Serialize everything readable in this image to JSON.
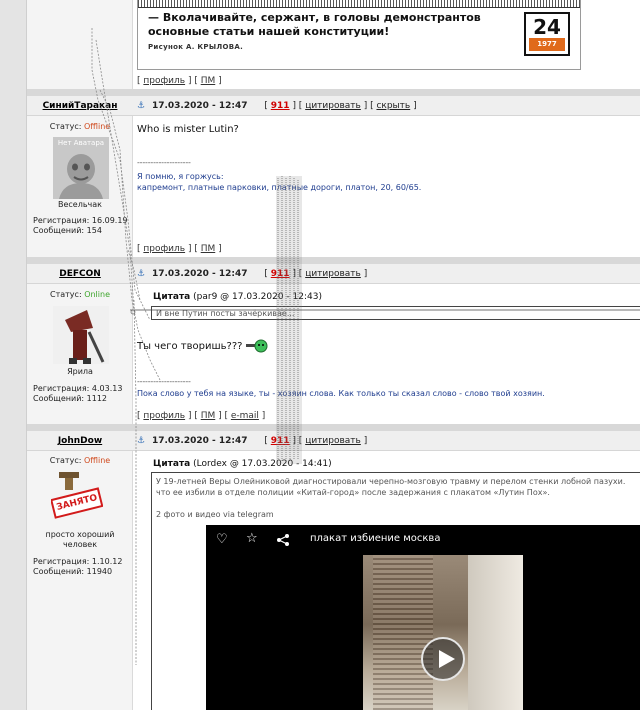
{
  "top_post": {
    "caption": "— Вколачивайте, сержант, в головы демонстрантов основные статьи нашей конституции!",
    "credit": "Рисунок А. КРЫЛОВА.",
    "badge_number": "24",
    "badge_year": "1977",
    "links": [
      "профиль",
      "ПМ"
    ]
  },
  "posts": [
    {
      "author": "СинийТаракан",
      "date": "17.03.2020 - 12:47",
      "post_number": "911",
      "actions": [
        "цитировать",
        "скрыть"
      ],
      "status_label": "Статус:",
      "status": "Offline",
      "avatar_text": [
        "Нет Аватара"
      ],
      "rank": "Весельчак",
      "registration": "Регистрация: 16.09.19",
      "messages": "Сообщений: 154",
      "body": "Who is mister Lutin?",
      "dashes": "--------------------",
      "signature": [
        "Я помню, я горжусь:",
        "капремонт, платные парковки, платные дороги, платон, 20, 60/65."
      ],
      "links": [
        "профиль",
        "ПМ"
      ]
    },
    {
      "author": "DEFCON",
      "date": "17.03.2020 - 12:47",
      "post_number": "911",
      "actions": [
        "цитировать"
      ],
      "status_label": "Статус:",
      "status": "Online",
      "rank": "Ярила",
      "registration": "Регистрация: 4.03.13",
      "messages": "Сообщений: 1112",
      "quote_label": "Цитата",
      "quote_source": "(par9 @ 17.03.2020 - 12:43)",
      "quote_text": "И вне Путин посты зачёркивае...",
      "body": "Ты чего творишь???",
      "dashes": "--------------------",
      "signature": [
        "Пока слово у тебя на языке, ты - хозяин слова. Как только ты сказал слово - слово твой хозяин."
      ],
      "links": [
        "профиль",
        "ПМ",
        "e-mail"
      ]
    },
    {
      "author": "JohnDow",
      "date": "17.03.2020 - 12:47",
      "post_number": "911",
      "actions": [
        "цитировать"
      ],
      "status_label": "Статус:",
      "status": "Offline",
      "avatar_stamp": "ЗАНЯТО",
      "rank": "просто хороший человек",
      "registration": "Регистрация: 1.10.12",
      "messages": "Сообщений: 11940",
      "quote_label": "Цитата",
      "quote_source": "(Lordex @ 17.03.2020 - 14:41)",
      "quote_text": "У 19-летней Веры Олейниковой диагностировали черепно-мозговую травму и перелом стенки лобной пазухи. что ее избили в отделе полиции «Китай-город» после задержания с плакатом «Лутин Пох».",
      "quote_text2": "2 фото и видео via telegram",
      "video_title": "плакат избиение москва"
    }
  ],
  "colors": {
    "accent_link": "#d00000",
    "offline": "#d04a1e",
    "online": "#3fa62e",
    "signature": "#1f3d8f"
  }
}
